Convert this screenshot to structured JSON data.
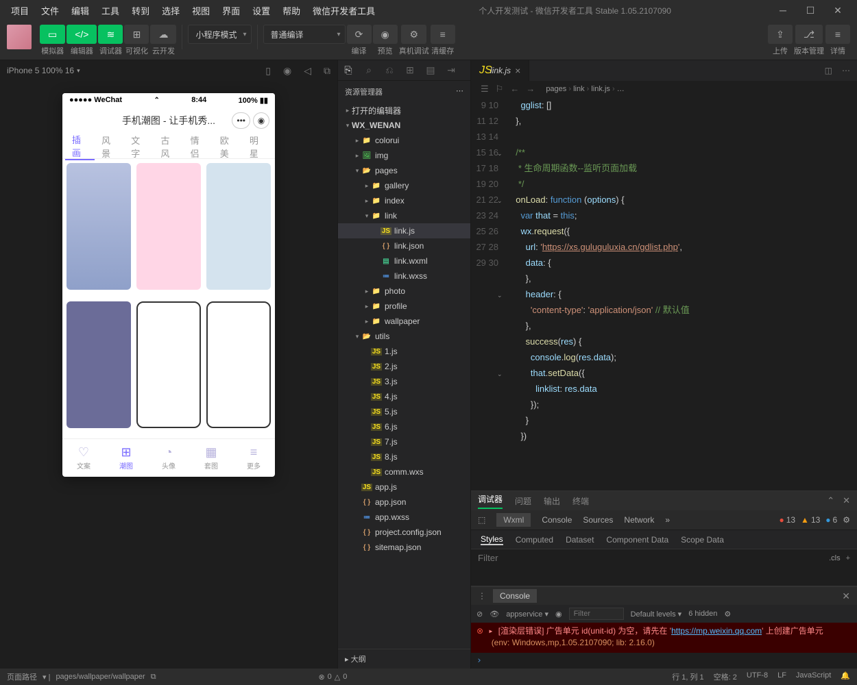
{
  "titlebar": {
    "menus": [
      "项目",
      "文件",
      "编辑",
      "工具",
      "转到",
      "选择",
      "视图",
      "界面",
      "设置",
      "帮助",
      "微信开发者工具"
    ],
    "title": "个人开发测试 - 微信开发者工具 Stable 1.05.2107090"
  },
  "toolbar": {
    "sim": "模拟器",
    "editor": "编辑器",
    "debugger": "调试器",
    "visual": "可视化",
    "cloud": "云开发",
    "mode": "小程序模式",
    "compileMode": "普通编译",
    "compile": "编译",
    "preview": "预览",
    "realDebug": "真机调试",
    "clearCache": "清缓存",
    "upload": "上传",
    "version": "版本管理",
    "details": "详情"
  },
  "sim": {
    "device": "iPhone 5 100% 16",
    "statusLeft": "●●●●● WeChat",
    "time": "8:44",
    "battery": "100%",
    "appTitle": "手机潮图 - 让手机秀...",
    "tabs": [
      "插画",
      "风景",
      "文字",
      "古风",
      "情侣",
      "欧美",
      "明星"
    ],
    "bottomNav": [
      "文案",
      "潮图",
      "头像",
      "套图",
      "更多"
    ]
  },
  "explorer": {
    "title": "资源管理器",
    "openedEditors": "打开的编辑器",
    "root": "WX_WENAN",
    "tree": [
      {
        "d": 1,
        "t": "folder",
        "n": "colorui",
        "open": false
      },
      {
        "d": 1,
        "t": "folder-img",
        "n": "img",
        "open": false
      },
      {
        "d": 1,
        "t": "folder-pages",
        "n": "pages",
        "open": true
      },
      {
        "d": 2,
        "t": "folder",
        "n": "gallery",
        "open": false
      },
      {
        "d": 2,
        "t": "folder",
        "n": "index",
        "open": false
      },
      {
        "d": 2,
        "t": "folder",
        "n": "link",
        "open": true,
        "sel": false
      },
      {
        "d": 3,
        "t": "js",
        "n": "link.js",
        "sel": true
      },
      {
        "d": 3,
        "t": "json",
        "n": "link.json"
      },
      {
        "d": 3,
        "t": "wxml",
        "n": "link.wxml"
      },
      {
        "d": 3,
        "t": "wxss",
        "n": "link.wxss"
      },
      {
        "d": 2,
        "t": "folder",
        "n": "photo",
        "open": false
      },
      {
        "d": 2,
        "t": "folder",
        "n": "profile",
        "open": false
      },
      {
        "d": 2,
        "t": "folder",
        "n": "wallpaper",
        "open": false
      },
      {
        "d": 1,
        "t": "folder-util",
        "n": "utils",
        "open": true
      },
      {
        "d": 2,
        "t": "js",
        "n": "1.js"
      },
      {
        "d": 2,
        "t": "js",
        "n": "2.js"
      },
      {
        "d": 2,
        "t": "js",
        "n": "3.js"
      },
      {
        "d": 2,
        "t": "js",
        "n": "4.js"
      },
      {
        "d": 2,
        "t": "js",
        "n": "5.js"
      },
      {
        "d": 2,
        "t": "js",
        "n": "6.js"
      },
      {
        "d": 2,
        "t": "js",
        "n": "7.js"
      },
      {
        "d": 2,
        "t": "js",
        "n": "8.js"
      },
      {
        "d": 2,
        "t": "wxs",
        "n": "comm.wxs"
      },
      {
        "d": 1,
        "t": "js",
        "n": "app.js"
      },
      {
        "d": 1,
        "t": "json",
        "n": "app.json"
      },
      {
        "d": 1,
        "t": "wxss",
        "n": "app.wxss"
      },
      {
        "d": 1,
        "t": "json",
        "n": "project.config.json"
      },
      {
        "d": 1,
        "t": "json",
        "n": "sitemap.json"
      }
    ],
    "outline": "大纲"
  },
  "editor": {
    "tab": "link.js",
    "breadcrumbs": [
      "pages",
      "link",
      "link.js",
      "…"
    ],
    "startLine": 9,
    "lines": [
      {
        "html": "    <span class='c-prop'>gglist</span>: []"
      },
      {
        "html": "  },"
      },
      {
        "html": ""
      },
      {
        "html": "  <span class='c-com'>/**</span>"
      },
      {
        "html": "<span class='c-com'>   * 生命周期函数--监听页面加载</span>"
      },
      {
        "html": "<span class='c-com'>   */</span>"
      },
      {
        "html": "  <span class='c-fn'>onLoad</span>: <span class='c-key'>function</span> (<span class='c-prop'>options</span>) {"
      },
      {
        "html": "    <span class='c-key'>var</span> <span class='c-prop'>that</span> = <span class='c-this'>this</span>;"
      },
      {
        "html": "    <span class='c-prop'>wx</span>.<span class='c-fn'>request</span>({"
      },
      {
        "html": "      <span class='c-prop'>url</span>: <span class='c-str'>'</span><span class='c-url'>https://xs.guluguluxia.cn/gdlist.php</span><span class='c-str'>'</span>,"
      },
      {
        "html": "      <span class='c-prop'>data</span>: {"
      },
      {
        "html": "      },"
      },
      {
        "html": "      <span class='c-prop'>header</span>: {"
      },
      {
        "html": "        <span class='c-str'>'content-type'</span>: <span class='c-str'>'application/json'</span> <span class='c-com'>// 默认值</span>"
      },
      {
        "html": "      },"
      },
      {
        "html": "      <span class='c-fn'>success</span>(<span class='c-prop'>res</span>) {"
      },
      {
        "html": "        <span class='c-prop'>console</span>.<span class='c-fn'>log</span>(<span class='c-prop'>res</span>.<span class='c-prop'>data</span>);"
      },
      {
        "html": "        <span class='c-prop'>that</span>.<span class='c-fn'>setData</span>({"
      },
      {
        "html": "          <span class='c-prop'>linklist</span>: <span class='c-prop'>res</span>.<span class='c-prop'>data</span>"
      },
      {
        "html": "        });"
      },
      {
        "html": "      }"
      },
      {
        "html": "    })"
      }
    ],
    "folds": [
      12,
      15,
      21,
      26
    ]
  },
  "debugger": {
    "tabs": [
      "调试器",
      "问题",
      "输出",
      "终端"
    ],
    "devtools": [
      "Wxml",
      "Console",
      "Sources",
      "Network"
    ],
    "errors": 13,
    "warns": 13,
    "infos": 6,
    "styleTabs": [
      "Styles",
      "Computed",
      "Dataset",
      "Component Data",
      "Scope Data"
    ],
    "filterPlaceholder": "Filter",
    "cls": ".cls",
    "consoleLabel": "Console",
    "appservice": "appservice",
    "defaultLevels": "Default levels",
    "hidden": "6 hidden",
    "consoleError1": "[渲染层错误] 广告单元 id(unit-id) 为空，请先在 '",
    "consoleErrorLink": "https://mp.weixin.qq.com",
    "consoleError2": "' 上创建广告单元",
    "consoleEnv": "(env: Windows,mp,1.05.2107090; lib: 2.16.0)"
  },
  "statusbar": {
    "pathLabel": "页面路径",
    "path": "pages/wallpaper/wallpaper",
    "errs": "0",
    "warns": "0",
    "pos": "行 1, 列 1",
    "spaces": "空格: 2",
    "encoding": "UTF-8",
    "eol": "LF",
    "lang": "JavaScript"
  }
}
